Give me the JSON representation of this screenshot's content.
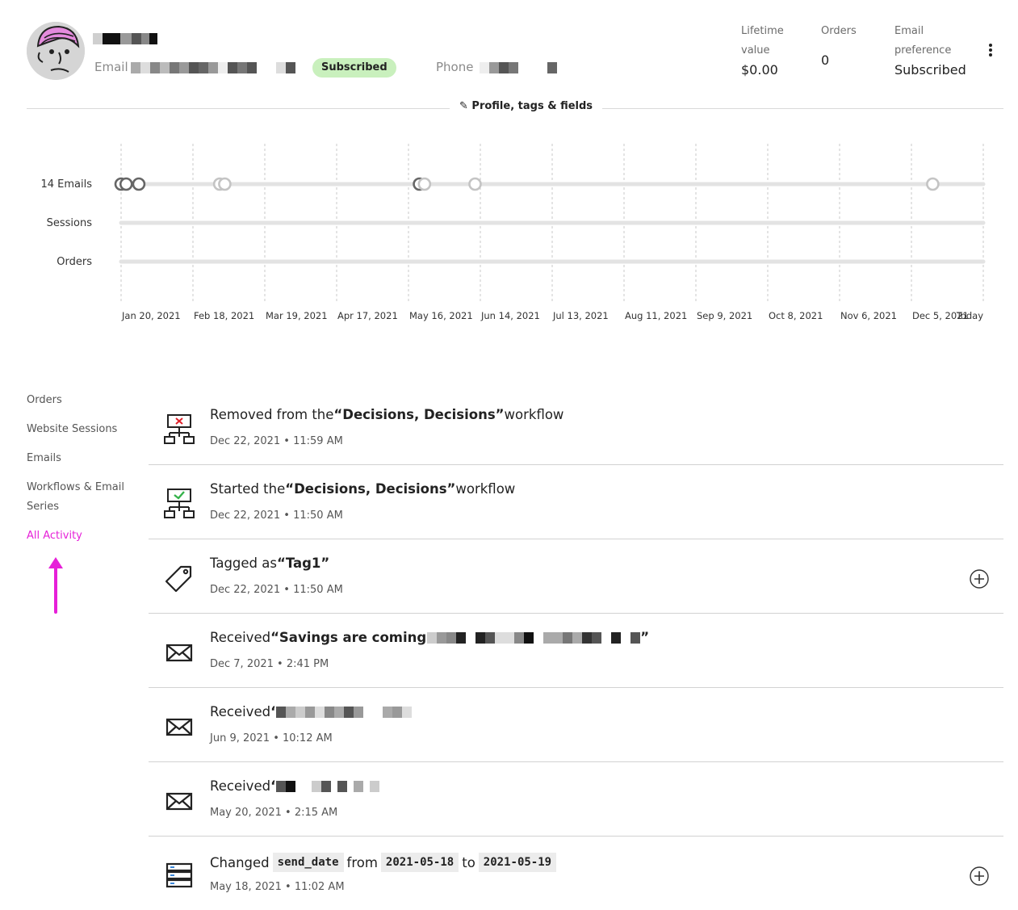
{
  "header": {
    "email_label": "Email",
    "subscribed_badge": "Subscribed",
    "phone_label": "Phone",
    "stats": [
      {
        "label_line1": "Lifetime",
        "label_line2": "value",
        "value": "$0.00"
      },
      {
        "label_line1": "Orders",
        "label_line2": "",
        "value": "0"
      },
      {
        "label_line1": "Email",
        "label_line2": "preference",
        "value": "Subscribed"
      }
    ],
    "profile_link": "Profile, tags & fields",
    "colors": {
      "badge": "#c9f0bd",
      "accent": "#e620d8"
    }
  },
  "chart_data": {
    "type": "scatter",
    "rows": [
      "14 Emails",
      "Sessions",
      "Orders"
    ],
    "x_ticks": [
      "Jan 20, 2021",
      "Feb 18, 2021",
      "Mar 19, 2021",
      "Apr 17, 2021",
      "May 16, 2021",
      "Jun 14, 2021",
      "Jul 13, 2021",
      "Aug 11, 2021",
      "Sep 9, 2021",
      "Oct 8, 2021",
      "Nov 6, 2021",
      "Dec 5, 2021",
      "Today"
    ],
    "x_range": [
      "2021-01-20",
      "2021-12-27"
    ],
    "events": [
      {
        "row": "14 Emails",
        "date": "2021-01-20",
        "style": "dark"
      },
      {
        "row": "14 Emails",
        "date": "2021-01-22",
        "style": "dark"
      },
      {
        "row": "14 Emails",
        "date": "2021-01-27",
        "style": "dark"
      },
      {
        "row": "14 Emails",
        "date": "2021-02-28",
        "style": "light"
      },
      {
        "row": "14 Emails",
        "date": "2021-03-02",
        "style": "light"
      },
      {
        "row": "14 Emails",
        "date": "2021-05-18",
        "style": "dark"
      },
      {
        "row": "14 Emails",
        "date": "2021-05-20",
        "style": "light"
      },
      {
        "row": "14 Emails",
        "date": "2021-06-09",
        "style": "light"
      },
      {
        "row": "14 Emails",
        "date": "2021-12-07",
        "style": "light"
      }
    ],
    "grid": "vertical dashed"
  },
  "nav": {
    "items": [
      {
        "label": "Orders",
        "active": false
      },
      {
        "label": "Website Sessions",
        "active": false
      },
      {
        "label": "Emails",
        "active": false
      },
      {
        "label": "Workflows & Email Series",
        "active": false
      },
      {
        "label": "All Activity",
        "active": true
      }
    ]
  },
  "activity": [
    {
      "icon": "workflow-removed-icon",
      "prefix": "Removed from the ",
      "quote": "“Decisions, Decisions”",
      "suffix": " workflow",
      "time": "Dec 22, 2021 • 11:59 AM"
    },
    {
      "icon": "workflow-started-icon",
      "prefix": "Started the ",
      "quote": "“Decisions, Decisions”",
      "suffix": " workflow",
      "time": "Dec 22, 2021 • 11:50 AM"
    },
    {
      "icon": "tag-icon",
      "prefix": "Tagged as ",
      "quote": "“Tag1”",
      "suffix": "",
      "time": "Dec 22, 2021 • 11:50 AM"
    },
    {
      "icon": "envelope-icon",
      "prefix": "Received ",
      "quote": "“Savings are coming",
      "suffix": "”",
      "time": "Dec 7, 2021 • 2:41 PM"
    },
    {
      "icon": "envelope-icon",
      "prefix": "Received ",
      "quote": "‘",
      "suffix": "",
      "time": "Jun 9, 2021 • 10:12 AM"
    },
    {
      "icon": "envelope-icon",
      "prefix": "Received ",
      "quote": "‘",
      "suffix": "",
      "time": "May 20, 2021 • 2:15 AM"
    },
    {
      "icon": "database-icon",
      "prefix": "Changed",
      "field": "send_date",
      "from_word": "from",
      "from_value": "2021-05-18",
      "to_word": "to",
      "to_value": "2021-05-19",
      "time": "May 18, 2021 • 11:02 AM"
    }
  ]
}
